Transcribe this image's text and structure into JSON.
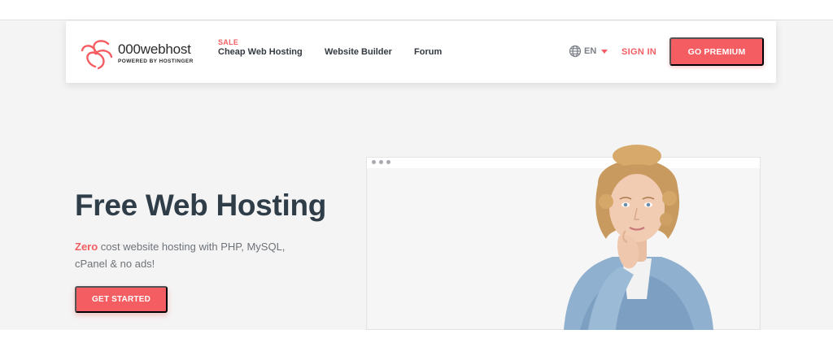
{
  "brand": {
    "name": "000webhost",
    "tagline": "POWERED BY HOSTINGER",
    "accent": "#f45e62"
  },
  "nav": {
    "sale_badge": "SALE",
    "items": [
      {
        "label": "Cheap Web Hosting"
      },
      {
        "label": "Website Builder"
      },
      {
        "label": "Forum"
      }
    ],
    "language": "EN",
    "sign_in": "SIGN IN",
    "premium": "GO PREMIUM"
  },
  "hero": {
    "title": "Free Web Hosting",
    "desc_highlight": "Zero",
    "desc_rest": " cost website hosting with PHP, MySQL, cPanel & no ads!",
    "cta": "GET STARTED"
  },
  "icons": {
    "logo": "000webhost-logo-mark",
    "language": "globe-icon",
    "dropdown": "caret-down-icon"
  }
}
